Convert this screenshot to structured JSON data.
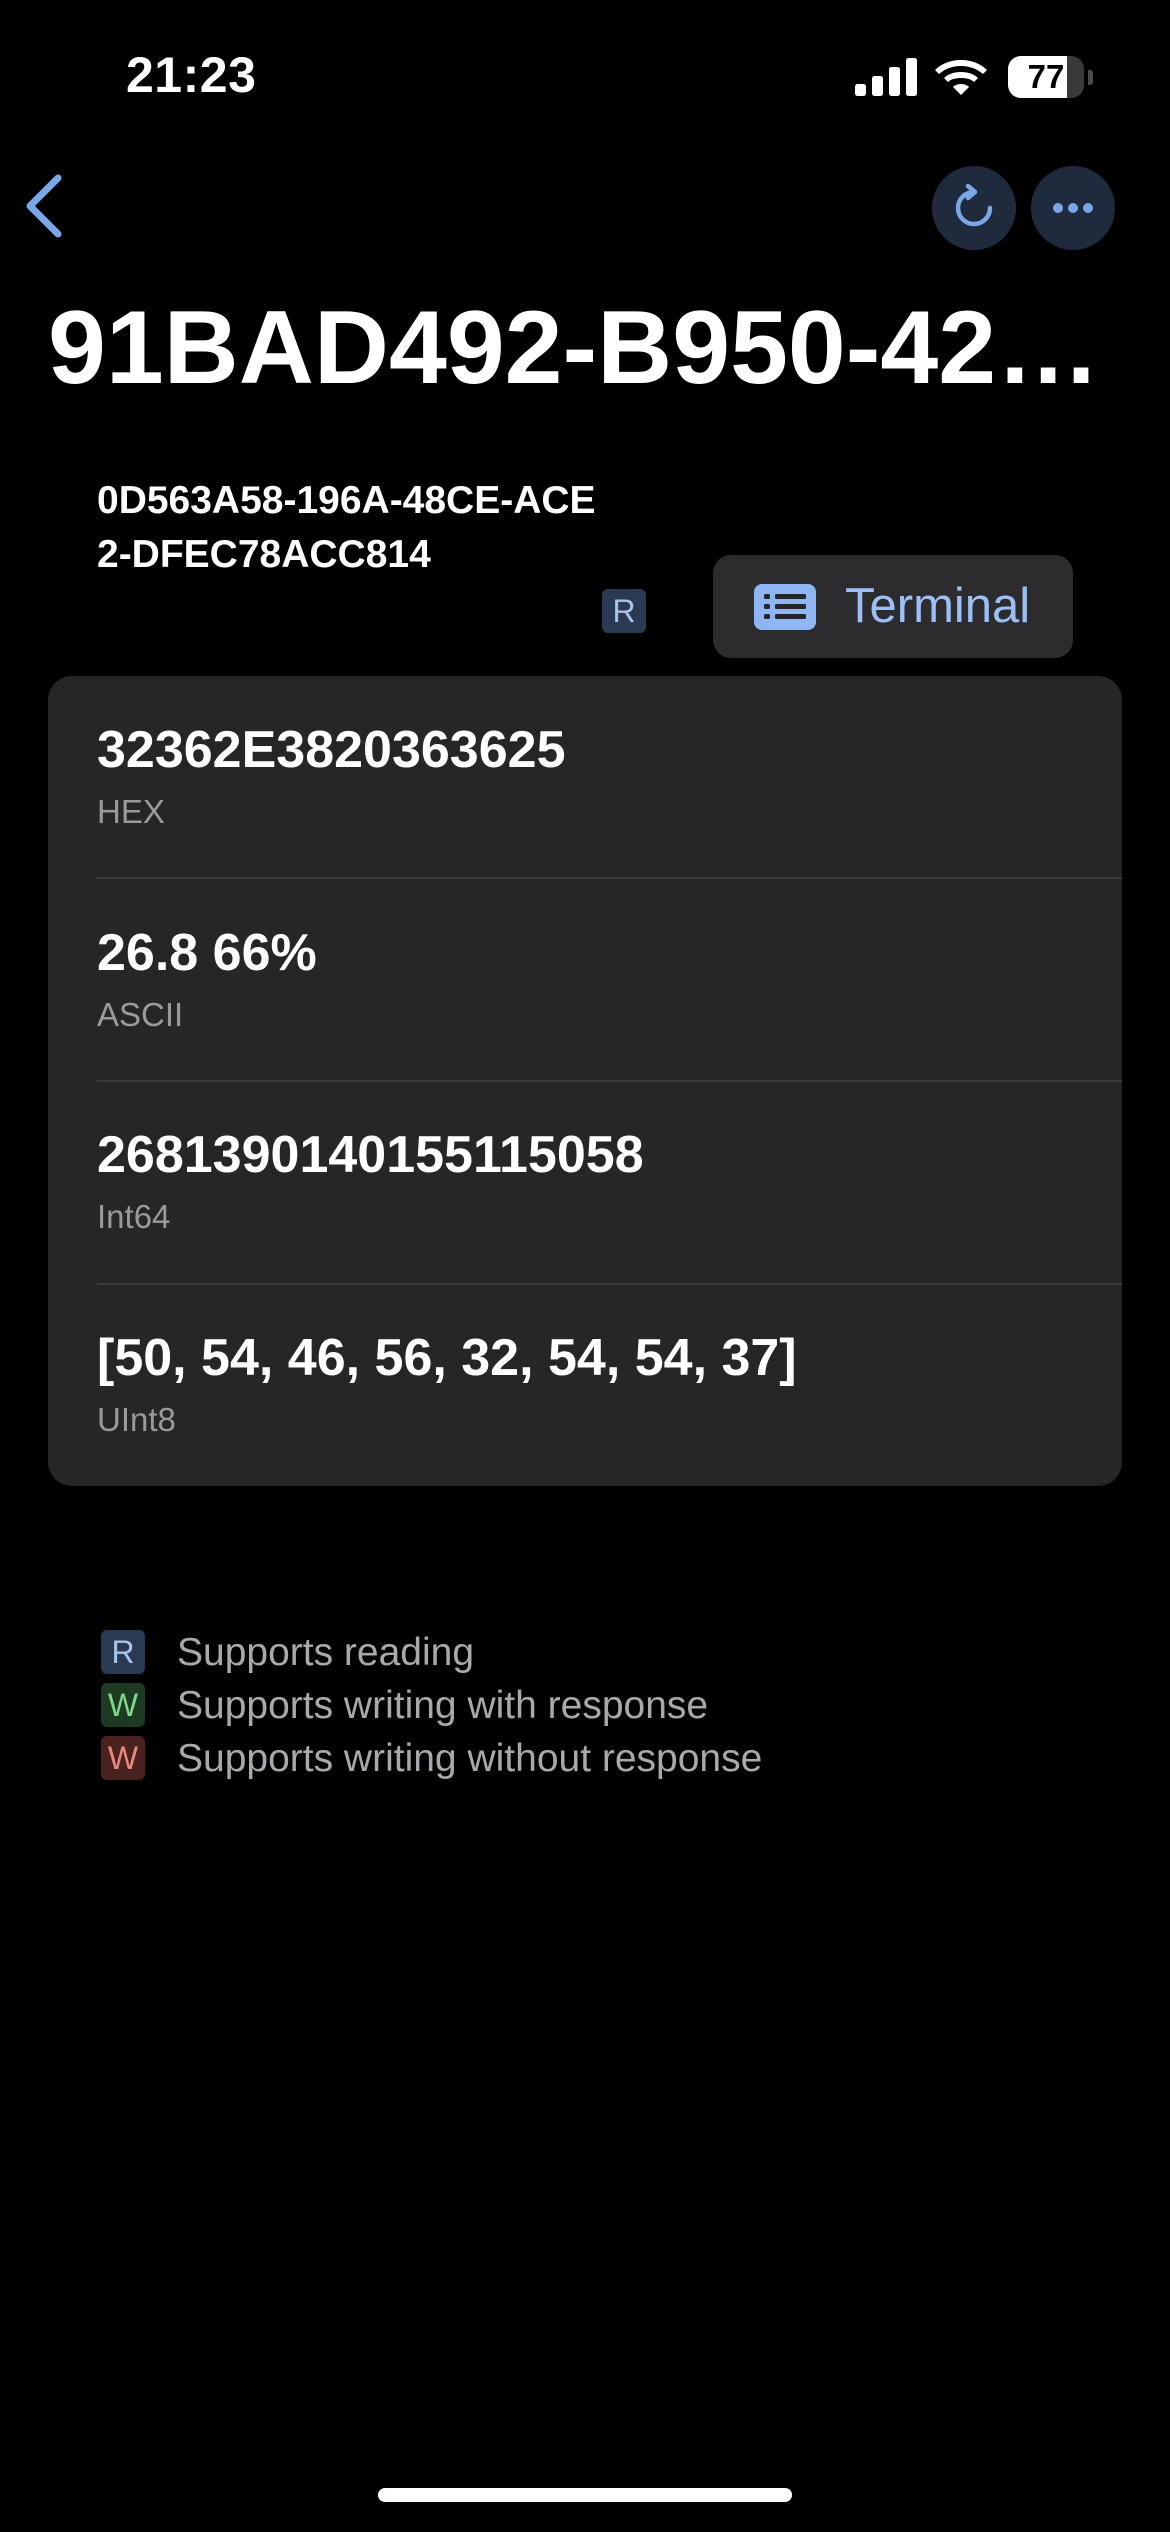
{
  "status_bar": {
    "time": "21:23",
    "battery_level": "77",
    "battery_fraction": 0.77,
    "icons": [
      "signal-icon",
      "wifi-icon",
      "battery-icon"
    ]
  },
  "nav": {
    "back_icon": "chevron-left-icon",
    "refresh_icon": "refresh-icon",
    "more_icon": "ellipsis-icon"
  },
  "title": "91BAD492-B950-42…",
  "characteristic": {
    "uuid": "0D563A58-196A-48CE-ACE2-DFEC78ACC814",
    "property_badge": "R",
    "terminal_label": "Terminal",
    "terminal_icon": "list-icon"
  },
  "values": [
    {
      "value": "32362E3820363625",
      "label": "HEX"
    },
    {
      "value": "26.8 66%",
      "label": "ASCII"
    },
    {
      "value": "2681390140155115058",
      "label": "Int64"
    },
    {
      "value": "[50, 54, 46, 56, 32, 54, 54, 37]",
      "label": "UInt8"
    }
  ],
  "legend": [
    {
      "badge": "R",
      "text": "Supports reading"
    },
    {
      "badge": "W",
      "text": "Supports writing with response"
    },
    {
      "badge": "W",
      "text": "Supports writing without response"
    }
  ],
  "colors": {
    "background": "#000000",
    "card": "#262628",
    "accent": "#9cc0f5",
    "badge_read": "#2a3a52",
    "badge_write_response": "#1e3a22",
    "badge_write_no_response": "#4a2220"
  }
}
